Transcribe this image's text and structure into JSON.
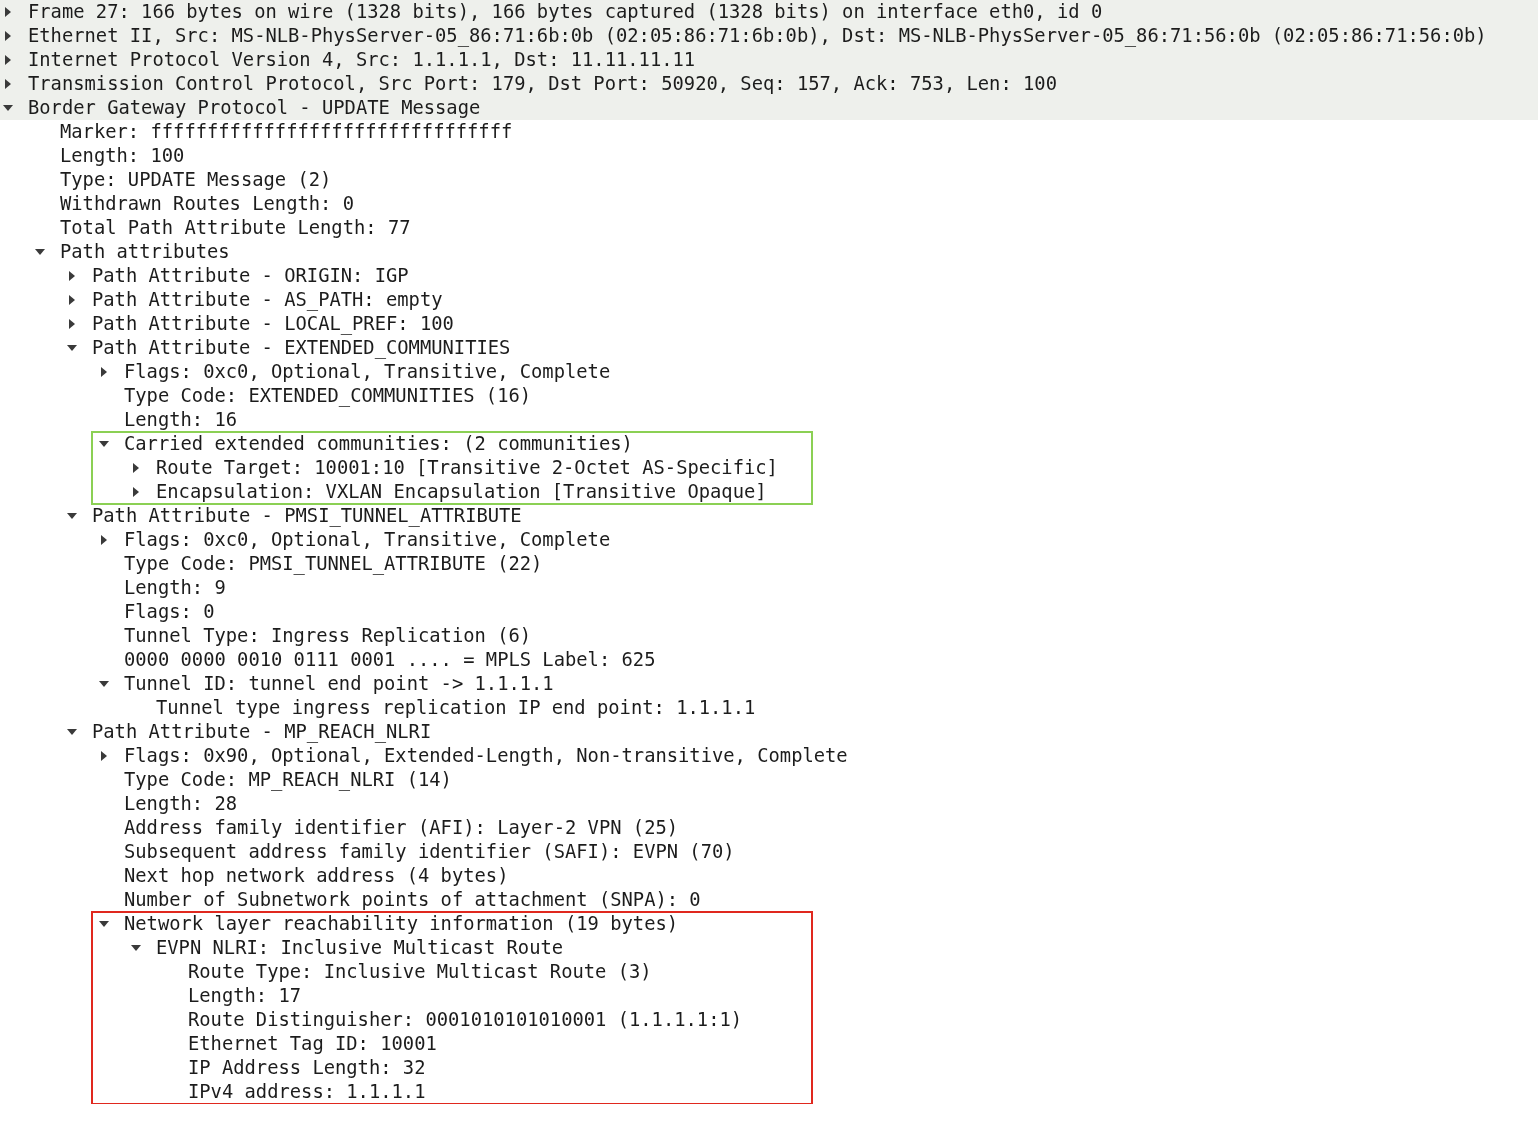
{
  "packet_details": {
    "nodes": [
      {
        "text": "Frame 27: 166 bytes on wire (1328 bits), 166 bytes captured (1328 bits) on interface eth0, id 0",
        "expanded": false,
        "shaded": true
      },
      {
        "text": "Ethernet II, Src: MS-NLB-PhysServer-05_86:71:6b:0b (02:05:86:71:6b:0b), Dst: MS-NLB-PhysServer-05_86:71:56:0b (02:05:86:71:56:0b)",
        "expanded": false,
        "shaded": true
      },
      {
        "text": "Internet Protocol Version 4, Src: 1.1.1.1, Dst: 11.11.11.11",
        "expanded": false,
        "shaded": true
      },
      {
        "text": "Transmission Control Protocol, Src Port: 179, Dst Port: 50920, Seq: 157, Ack: 753, Len: 100",
        "expanded": false,
        "shaded": true
      },
      {
        "text": "Border Gateway Protocol - UPDATE Message",
        "expanded": true,
        "shaded": true,
        "children": [
          {
            "text": "Marker: ffffffffffffffffffffffffffffffff"
          },
          {
            "text": "Length: 100"
          },
          {
            "text": "Type: UPDATE Message (2)"
          },
          {
            "text": "Withdrawn Routes Length: 0"
          },
          {
            "text": "Total Path Attribute Length: 77"
          },
          {
            "text": "Path attributes",
            "expanded": true,
            "children": [
              {
                "text": "Path Attribute - ORIGIN: IGP",
                "expanded": false
              },
              {
                "text": "Path Attribute - AS_PATH: empty",
                "expanded": false
              },
              {
                "text": "Path Attribute - LOCAL_PREF: 100",
                "expanded": false
              },
              {
                "text": "Path Attribute - EXTENDED_COMMUNITIES",
                "expanded": true,
                "children": [
                  {
                    "text": "Flags: 0xc0, Optional, Transitive, Complete",
                    "expanded": false
                  },
                  {
                    "text": "Type Code: EXTENDED_COMMUNITIES (16)"
                  },
                  {
                    "text": "Length: 16"
                  },
                  {
                    "text": "Carried extended communities: (2 communities)",
                    "expanded": true,
                    "color": "#8bd054",
                    "children": [
                      {
                        "text": "Route Target: 10001:10 [Transitive 2-Octet AS-Specific]",
                        "expanded": false
                      },
                      {
                        "text": "Encapsulation: VXLAN Encapsulation [Transitive Opaque]",
                        "expanded": false
                      }
                    ]
                  }
                ]
              },
              {
                "text": "Path Attribute - PMSI_TUNNEL_ATTRIBUTE",
                "expanded": true,
                "children": [
                  {
                    "text": "Flags: 0xc0, Optional, Transitive, Complete",
                    "expanded": false
                  },
                  {
                    "text": "Type Code: PMSI_TUNNEL_ATTRIBUTE (22)"
                  },
                  {
                    "text": "Length: 9"
                  },
                  {
                    "text": "Flags: 0"
                  },
                  {
                    "text": "Tunnel Type: Ingress Replication (6)"
                  },
                  {
                    "text": "0000 0000 0010 0111 0001 .... = MPLS Label: 625"
                  },
                  {
                    "text": "Tunnel ID: tunnel end point -> 1.1.1.1",
                    "expanded": true,
                    "children": [
                      {
                        "text": "Tunnel type ingress replication IP end point: 1.1.1.1"
                      }
                    ]
                  }
                ]
              },
              {
                "text": "Path Attribute - MP_REACH_NLRI",
                "expanded": true,
                "children": [
                  {
                    "text": "Flags: 0x90, Optional, Extended-Length, Non-transitive, Complete",
                    "expanded": false
                  },
                  {
                    "text": "Type Code: MP_REACH_NLRI (14)"
                  },
                  {
                    "text": "Length: 28"
                  },
                  {
                    "text": "Address family identifier (AFI): Layer-2 VPN (25)"
                  },
                  {
                    "text": "Subsequent address family identifier (SAFI): EVPN (70)"
                  },
                  {
                    "text": "Next hop network address (4 bytes)"
                  },
                  {
                    "text": "Number of Subnetwork points of attachment (SNPA): 0"
                  },
                  {
                    "text": "Network layer reachability information (19 bytes)",
                    "expanded": true,
                    "color": "#e0281e",
                    "children": [
                      {
                        "text": "EVPN NLRI: Inclusive Multicast Route",
                        "expanded": true,
                        "children": [
                          {
                            "text": "Route Type: Inclusive Multicast Route (3)"
                          },
                          {
                            "text": "Length: 17"
                          },
                          {
                            "text": "Route Distinguisher: 0001010101010001 (1.1.1.1:1)"
                          },
                          {
                            "text": "Ethernet Tag ID: 10001"
                          },
                          {
                            "text": "IP Address Length: 32"
                          },
                          {
                            "text": "IPv4 address: 1.1.1.1"
                          }
                        ]
                      }
                    ]
                  }
                ]
              }
            ]
          }
        ]
      }
    ]
  }
}
